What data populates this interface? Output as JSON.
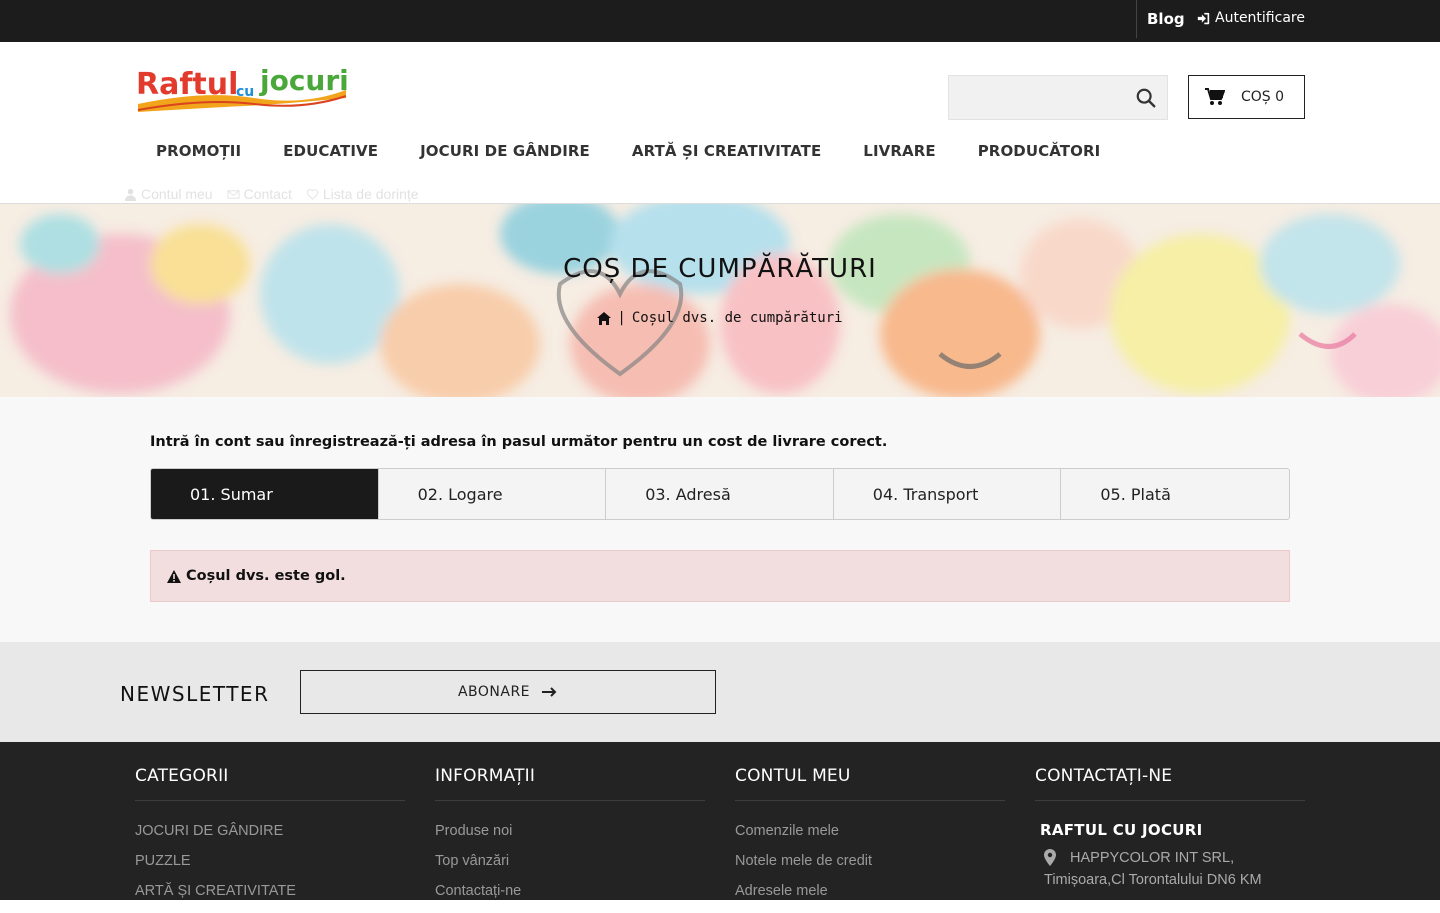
{
  "topbar": {
    "blog": "Blog",
    "login": "Autentificare"
  },
  "header": {
    "logo_text": {
      "part1": "Raftul",
      "part2": "cu",
      "part3": "jocuri"
    },
    "search_placeholder": "",
    "cart_label": "COȘ 0",
    "nav": [
      "PROMOȚII",
      "EDUCATIVE",
      "JOCURI DE GÂNDIRE",
      "ARTĂ ȘI CREATIVITATE",
      "LIVRARE",
      "PRODUCĂTORI"
    ],
    "secondary_links": [
      "Contul meu",
      "Contact",
      "Lista de dorințe"
    ]
  },
  "banner": {
    "title": "COȘ DE CUMPĂRĂTURI",
    "breadcrumb": "Coșul dvs. de cumpărături"
  },
  "main": {
    "notice": "Intră în cont sau înregistrează-ți adresa în pasul următor pentru un cost de livrare corect.",
    "steps": [
      "01. Sumar",
      "02. Logare",
      "03. Adresă",
      "04. Transport",
      "05. Plată"
    ],
    "alert": "Coșul dvs. este gol."
  },
  "newsletter": {
    "title": "NEWSLETTER",
    "button": "ABONARE"
  },
  "footer": {
    "categorii": {
      "title": "CATEGORII",
      "items": [
        "JOCURI DE GÂNDIRE",
        "PUZZLE",
        "ARTĂ ȘI CREATIVITATE"
      ]
    },
    "informatii": {
      "title": "INFORMAȚII",
      "items": [
        "Produse noi",
        "Top vânzări",
        "Contactați-ne"
      ]
    },
    "contul": {
      "title": "CONTUL MEU",
      "items": [
        "Comenzile mele",
        "Notele mele de credit",
        "Adresele mele"
      ]
    },
    "contact": {
      "title": "CONTACTAȚI-NE",
      "company": "RAFTUL CU JOCURI",
      "address_line1": "HAPPYCOLOR INT SRL,",
      "address_line2": "Timișoara,Cl Torontalului DN6 KM"
    }
  },
  "colors": {
    "topbar": "#1c1c1c",
    "footer": "#232323",
    "alert_bg": "#f2dede",
    "active_step": "#1a1a1a"
  }
}
